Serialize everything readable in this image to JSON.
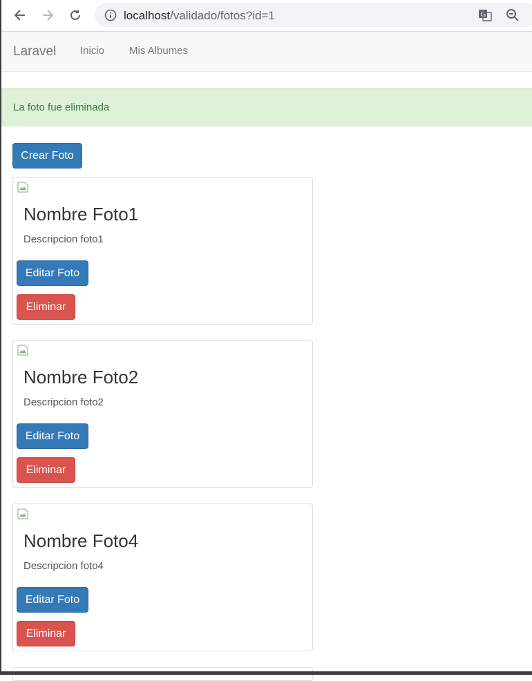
{
  "browser": {
    "url_host": "localhost",
    "url_path": "/validado/fotos?id=1"
  },
  "navbar": {
    "brand": "Laravel",
    "links": [
      "Inicio",
      "Mis Albumes"
    ]
  },
  "alert": {
    "message": "La foto fue eliminada"
  },
  "actions": {
    "create_label": "Crear Foto"
  },
  "photos": [
    {
      "title": "Nombre Foto1",
      "description": "Descripcion foto1",
      "edit_label": "Editar Foto",
      "delete_label": "Eliminar"
    },
    {
      "title": "Nombre Foto2",
      "description": "Descripcion foto2",
      "edit_label": "Editar Foto",
      "delete_label": "Eliminar"
    },
    {
      "title": "Nombre Foto4",
      "description": "Descripcion foto4",
      "edit_label": "Editar Foto",
      "delete_label": "Eliminar"
    }
  ],
  "colors": {
    "primary": "#337ab7",
    "danger": "#d9534f",
    "success_bg": "#dff0d8",
    "success_text": "#3c763d"
  }
}
